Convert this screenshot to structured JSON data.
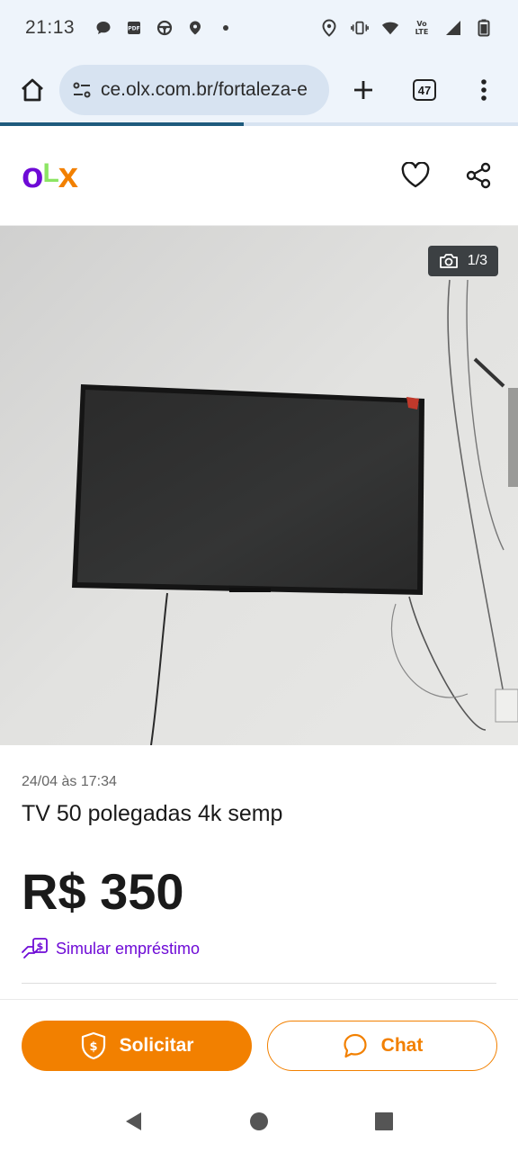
{
  "status_bar": {
    "time": "21:13",
    "left_icons": [
      "chat-bubble-icon",
      "pdf-icon",
      "steering-wheel-icon",
      "location-pin-icon",
      "dot-icon"
    ],
    "right_icons": [
      "location-icon",
      "vibrate-icon",
      "wifi-icon",
      "volte-icon",
      "signal-icon",
      "battery-icon"
    ],
    "volte_text": "Vo LTE"
  },
  "browser": {
    "url": "ce.olx.com.br/fortaleza-e",
    "tab_count": "47",
    "load_progress": 0.47
  },
  "header": {
    "logo_o": "o",
    "logo_l": "L",
    "logo_x": "x",
    "brand_colors": {
      "purple": "#6e0ad6",
      "green": "#8ce563",
      "orange": "#f28000"
    }
  },
  "gallery": {
    "counter": "1/3"
  },
  "ad": {
    "date": "24/04 às 17:34",
    "title": "TV 50 polegadas 4k semp",
    "price": "R$ 350",
    "loan_label": "Simular empréstimo"
  },
  "actions": {
    "solicitar_label": "Solicitar",
    "chat_label": "Chat"
  },
  "nav": {
    "icons": [
      "back-icon",
      "home-icon",
      "recents-icon"
    ]
  }
}
